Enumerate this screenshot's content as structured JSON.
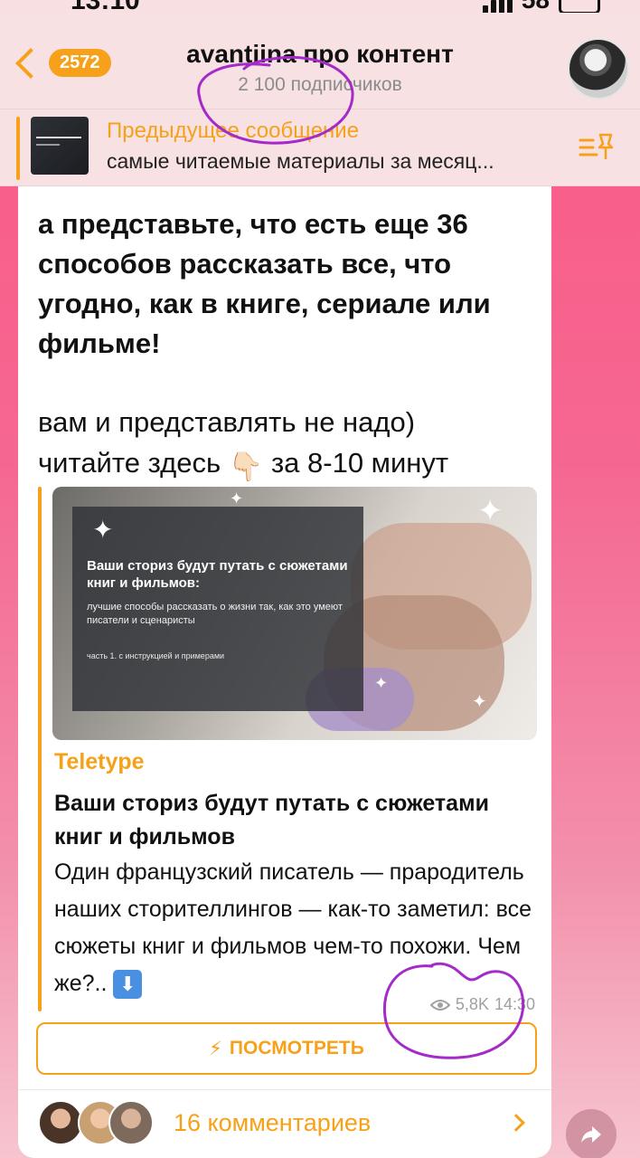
{
  "status_bar": {
    "time": "13:10",
    "battery": "58"
  },
  "header": {
    "back_badge": "2572",
    "title": "avantiina про контент",
    "subtitle": "2 100 подписчиков"
  },
  "pinned": {
    "title": "Предыдущее сообщение",
    "text": "самые читаемые материалы за месяц..."
  },
  "post": {
    "bold_text": "а представьте, что есть еще 36 способов рассказать все, что угодно, как в книге, сериале или фильме!",
    "line1": "вам и представлять не надо)",
    "line2_prefix": "читайте здесь",
    "line2_emoji": "👇🏻",
    "line2_suffix": "за 8-10 минут"
  },
  "link_preview": {
    "image": {
      "title": "Ваши сториз будут путать с сюжетами книг и фильмов:",
      "subtitle": "лучшие способы рассказать о жизни так, как это умеют писатели и сценаристы",
      "part": "часть 1. с инструкцией и примерами"
    },
    "site_name": "Teletype",
    "title": "Ваши сториз будут путать с сюжетами книг и фильмов",
    "description": "Один французский писатель — прародитель наших сторителлингов — как-то заметил: все сюжеты книг и фильмов чем-то похожи. Чем же?..",
    "download_emoji": "⬇"
  },
  "meta": {
    "views": "5,8K",
    "time": "14:30"
  },
  "view_button": {
    "icon": "⚡",
    "label": "ПОСМОТРЕТЬ"
  },
  "comments": {
    "label": "16 комментариев"
  },
  "colors": {
    "accent": "#f7a11a",
    "annotation": "#a42bc8"
  }
}
